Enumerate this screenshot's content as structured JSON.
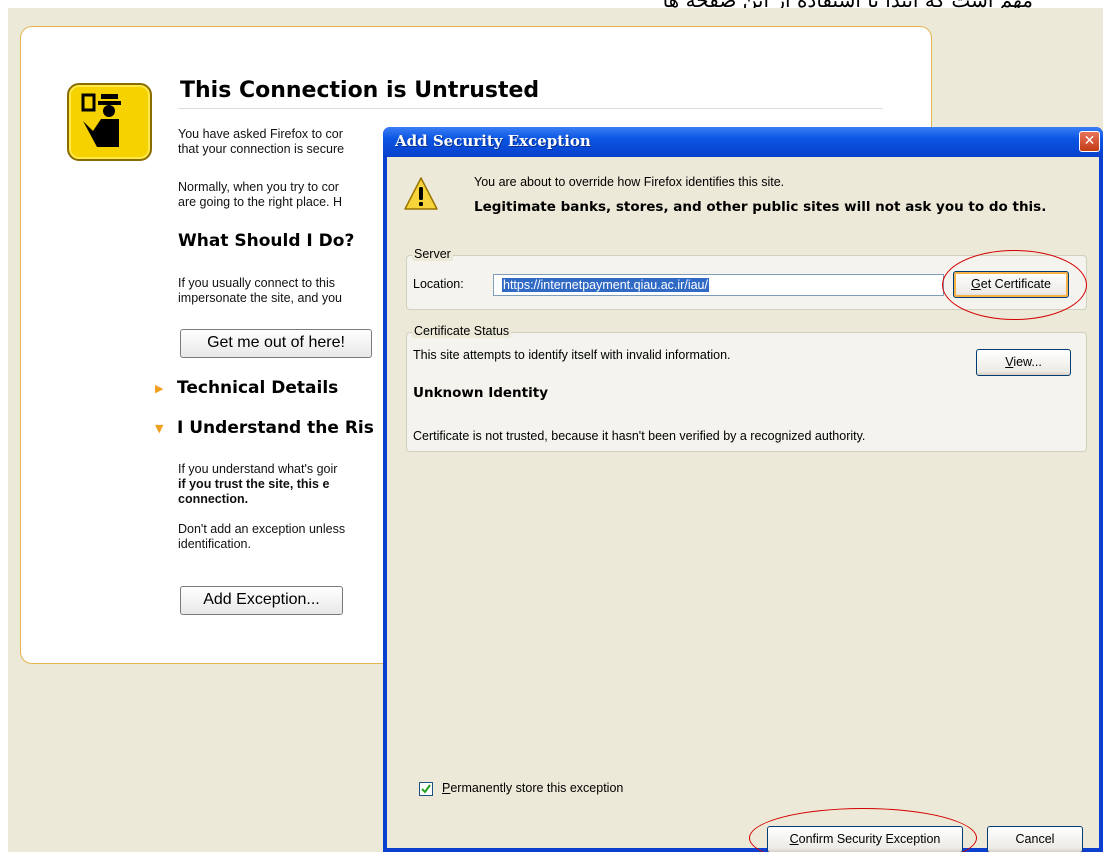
{
  "top_strip": {
    "text": "مهم است که ابتدا با استفاده از این صفحه ها"
  },
  "error_page": {
    "title": "This Connection is Untrusted",
    "intro_line1": "You have asked Firefox to cor",
    "intro_line2": "that your connection is secure",
    "normally_line1": "Normally, when you try to cor",
    "normally_line2": "are going to the right place. H",
    "what_heading": "What Should I Do?",
    "usually_line1": "If you usually connect to this",
    "usually_line2": "impersonate the site, and you",
    "get_out_button": "Get me out of here!",
    "technical_details": "Technical Details",
    "understand_risks": "I Understand the Ris",
    "understand_line1": "If you understand what's goir",
    "understand_line2": "if you trust the site, this e",
    "understand_line3": "connection.",
    "dont_add_line1": "Don't add an exception unless",
    "dont_add_line2": "identification.",
    "add_exception_button": "Add Exception..."
  },
  "dialog": {
    "title": "Add Security Exception",
    "close_glyph": "✕",
    "warning_line1": "You are about to override how Firefox identifies this site.",
    "warning_line2": "Legitimate banks, stores, and other public sites will not ask you to do this.",
    "server_legend": "Server",
    "location_label": "Location:",
    "location_value": "https://internetpayment.qiau.ac.ir/iau/",
    "get_certificate_prefix": "G",
    "get_certificate_rest": "et Certificate",
    "status_legend": "Certificate Status",
    "status_text": "This site attempts to identify itself with invalid information.",
    "view_prefix": "V",
    "view_rest": "iew...",
    "identity_heading": "Unknown Identity",
    "identity_text": "Certificate is not trusted, because it hasn't been verified by a recognized authority.",
    "permanent_prefix": "P",
    "permanent_rest": "ermanently store this exception",
    "permanent_checked": true,
    "confirm_prefix": "C",
    "confirm_rest": "onfirm Security Exception",
    "cancel": "Cancel"
  },
  "colors": {
    "titlebar": "#0a55e2",
    "dialog_bg": "#ece9d8",
    "card_border": "#e4b44c",
    "annotation_red": "#d40000",
    "selection": "#316ac5"
  },
  "icons": [
    "warning-shield-logo-icon",
    "warning-triangle-icon",
    "close-icon",
    "expand-arrow-icon",
    "collapse-arrow-icon",
    "checkmark-icon"
  ]
}
